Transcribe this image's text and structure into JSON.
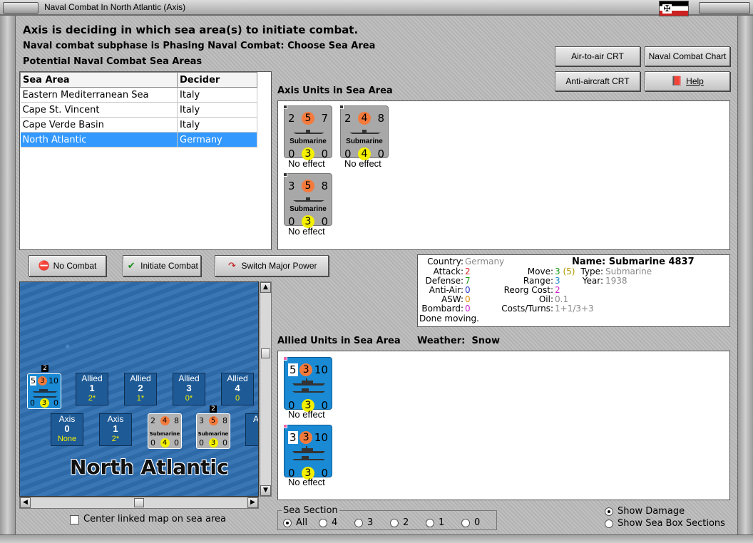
{
  "window": {
    "title": "Naval Combat In North Atlantic (Axis)"
  },
  "header": {
    "line1": "Axis is deciding in which sea area(s) to initiate combat.",
    "line2": "Naval combat subphase is Phasing Naval Combat: Choose Sea Area",
    "line3": "Potential Naval Combat Sea Areas"
  },
  "buttons": {
    "air_to_air": "Air-to-air CRT",
    "naval_chart": "Naval Combat Chart",
    "anti_aircraft": "Anti-aircraft CRT",
    "help": "Help",
    "no_combat": "No Combat",
    "initiate": "Initiate Combat",
    "switch": "Switch Major Power"
  },
  "sea_table": {
    "headers": [
      "Sea Area",
      "Decider"
    ],
    "rows": [
      [
        "Eastern Mediterranean Sea",
        "Italy"
      ],
      [
        "Cape St. Vincent",
        "Italy"
      ],
      [
        "Cape Verde Basin",
        "Italy"
      ],
      [
        "North Atlantic",
        "Germany"
      ]
    ],
    "selected_index": 3
  },
  "axis_units": {
    "label": "Axis Units in Sea Area",
    "units": [
      {
        "tl": "2",
        "tc": "5",
        "tr": "7",
        "name": "Submarine",
        "bl": "0",
        "bc": "3",
        "br": "0",
        "effect": "No effect"
      },
      {
        "tl": "2",
        "tc": "4",
        "tr": "8",
        "name": "Submarine",
        "bl": "0",
        "bc": "4",
        "br": "0",
        "effect": "No effect"
      },
      {
        "tl": "3",
        "tc": "5",
        "tr": "8",
        "name": "Submarine",
        "bl": "0",
        "bc": "3",
        "br": "0",
        "effect": "No effect"
      }
    ]
  },
  "info": {
    "country_label": "Country:",
    "country": "Germany",
    "attack_label": "Attack:",
    "attack": "2",
    "defense_label": "Defense:",
    "defense": "7",
    "antiair_label": "Anti-Air:",
    "antiair": "0",
    "asw_label": "ASW:",
    "asw": "0",
    "bombard_label": "Bombard:",
    "bombard": "0",
    "status": "Done moving.",
    "move_label": "Move:",
    "move": "3",
    "move_extra": "(5)",
    "range_label": "Range:",
    "range": "3",
    "reorg_label": "Reorg Cost:",
    "reorg": "2",
    "oil_label": "Oil:",
    "oil": "0.1",
    "costs_label": "Costs/Turns:",
    "costs": "1+1/3+3",
    "name_label": "Name:",
    "name": "Submarine 4837",
    "type_label": "Type:",
    "type": "Submarine",
    "year_label": "Year:",
    "year": "1938"
  },
  "allied_units": {
    "label": "Allied Units in Sea Area",
    "weather_label": "Weather:",
    "weather": "Snow",
    "units": [
      {
        "tl": "5",
        "tc": "3",
        "tr": "10",
        "bl": "0",
        "bc": "3",
        "br": "0",
        "effect": "No effect"
      },
      {
        "tl": "3",
        "tc": "3",
        "tr": "10",
        "bl": "0",
        "bc": "3",
        "br": "0",
        "effect": "No effect"
      }
    ]
  },
  "map": {
    "title": "North Atlantic",
    "allied_boxes": [
      {
        "label": "Allied",
        "num": "1",
        "sub": "2*"
      },
      {
        "label": "Allied",
        "num": "2",
        "sub": "1*"
      },
      {
        "label": "Allied",
        "num": "3",
        "sub": "0*"
      },
      {
        "label": "Allied",
        "num": "4",
        "sub": "0"
      }
    ],
    "axis_boxes": [
      {
        "label": "Axis",
        "num": "0",
        "sub": "None"
      },
      {
        "label": "Axis",
        "num": "1",
        "sub": "2*"
      },
      {
        "label": "A",
        "num": "",
        "sub": ""
      }
    ],
    "mini_allied": {
      "tag": "2",
      "tl": "5",
      "tc": "3",
      "tr": "10",
      "bl": "0",
      "bc": "3",
      "br": "0"
    },
    "mini_axis_1": {
      "tl": "2",
      "tc": "4",
      "tr": "8",
      "name": "Submarine",
      "bl": "0",
      "bc": "4",
      "br": "0"
    },
    "mini_axis_2": {
      "tag": "2",
      "tl": "3",
      "tc": "5",
      "tr": "8",
      "name": "Submarine",
      "bl": "0",
      "bc": "3",
      "br": "0"
    },
    "center_linked": "Center linked map on sea area"
  },
  "sea_section": {
    "label": "Sea Section",
    "options": [
      "All",
      "4",
      "3",
      "2",
      "1",
      "0"
    ],
    "selected": "All"
  },
  "display": {
    "show_damage": "Show Damage",
    "show_sections": "Show Sea Box Sections",
    "selected": "Show Damage"
  },
  "colors": {
    "allied_blue": "#1a8ad4",
    "selected_row": "#3399ff",
    "attack_orange": "#f47a3c",
    "defense_yellow": "#f4f000"
  }
}
